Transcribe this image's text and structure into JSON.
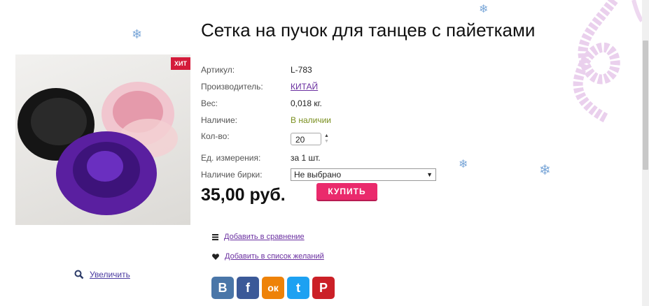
{
  "product": {
    "title": "Сетка на пучок для танцев с пайетками",
    "badge": "ХИТ",
    "zoom_label": "Увеличить"
  },
  "specs": {
    "article_label": "Артикул:",
    "article_value": "L-783",
    "maker_label": "Производитель:",
    "maker_value": "КИТАЙ",
    "weight_label": "Вес:",
    "weight_value": "0,018 кг.",
    "stock_label": "Наличие:",
    "stock_value": "В наличии",
    "qty_label": "Кол-во:",
    "qty_value": "20",
    "unit_label": "Ед. измерения:",
    "unit_value": "за 1 шт.",
    "tag_label": "Наличие бирки:",
    "tag_value": "Не выбрано"
  },
  "price": "35,00 руб.",
  "buy_label": "КУПИТЬ",
  "actions": {
    "compare": "Добавить в сравнение",
    "wishlist": "Добавить в список желаний"
  },
  "social": [
    {
      "name": "vk-icon",
      "glyph": "В",
      "color": "#4a76a8"
    },
    {
      "name": "facebook-icon",
      "glyph": "f",
      "color": "#3b5998"
    },
    {
      "name": "odnoklassniki-icon",
      "glyph": "ок",
      "color": "#ee8208"
    },
    {
      "name": "twitter-icon",
      "glyph": "t",
      "color": "#1da1f2"
    },
    {
      "name": "pinterest-icon",
      "glyph": "P",
      "color": "#cb2027"
    }
  ],
  "colors": {
    "accent": "#ea2a6c",
    "link": "#6a2fa0",
    "in_stock": "#7a8f1f"
  }
}
